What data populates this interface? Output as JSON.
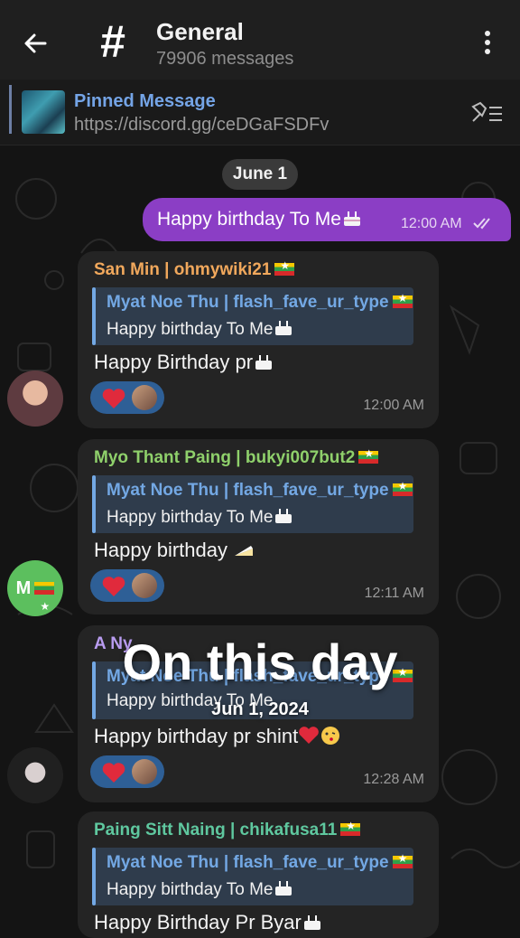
{
  "header": {
    "back_icon": "arrow-left-icon",
    "channel_icon": "hash-icon",
    "channel_symbol": "#",
    "title": "General",
    "subtitle": "79906 messages",
    "menu_icon": "more-vertical-icon"
  },
  "pinned": {
    "title": "Pinned Message",
    "link": "https://discord.gg/ceDGaFSDFv",
    "icon": "unpin-list-icon"
  },
  "date_separator": "June 1",
  "outgoing": {
    "text": "Happy birthday To Me",
    "time": "12:00 AM",
    "status_icon": "double-check-icon",
    "color": "#8b3ec5"
  },
  "messages": [
    {
      "sender": "San Min | ohmywiki21",
      "sender_color": "#f1a85c",
      "reply_name": "Myat Noe Thu | flash_fave_ur_type",
      "reply_text": "Happy birthday To Me",
      "text": "Happy Birthday pr",
      "time": "12:00 AM"
    },
    {
      "sender": "Myo Thant Paing | bukyi007but2",
      "sender_color": "#8fd06b",
      "reply_name": "Myat Noe Thu | flash_fave_ur_type",
      "reply_text": "Happy birthday To Me",
      "text": "Happy birthday",
      "time": "12:11 AM",
      "avatar_label": "M"
    },
    {
      "sender": "A Ny",
      "sender_color": "#b99cf0",
      "reply_name": "Myat Noe Thu | flash_fave_ur_type",
      "reply_text": "Happy birthday To Me",
      "text": "Happy birthday pr shint",
      "time": "12:28 AM"
    },
    {
      "sender": "Paing Sitt Naing | chikafusa11",
      "sender_color": "#5fc89f",
      "reply_name": "Myat Noe Thu | flash_fave_ur_type",
      "reply_text": "Happy birthday To Me",
      "text": "Happy Birthday Pr Byar"
    }
  ],
  "overlay": {
    "title": "On this day",
    "date": "Jun 1, 2024"
  },
  "colors": {
    "reply_accent": "#73a8e4",
    "reaction_bg": "#2e5f96",
    "bubble_bg": "#242424"
  }
}
